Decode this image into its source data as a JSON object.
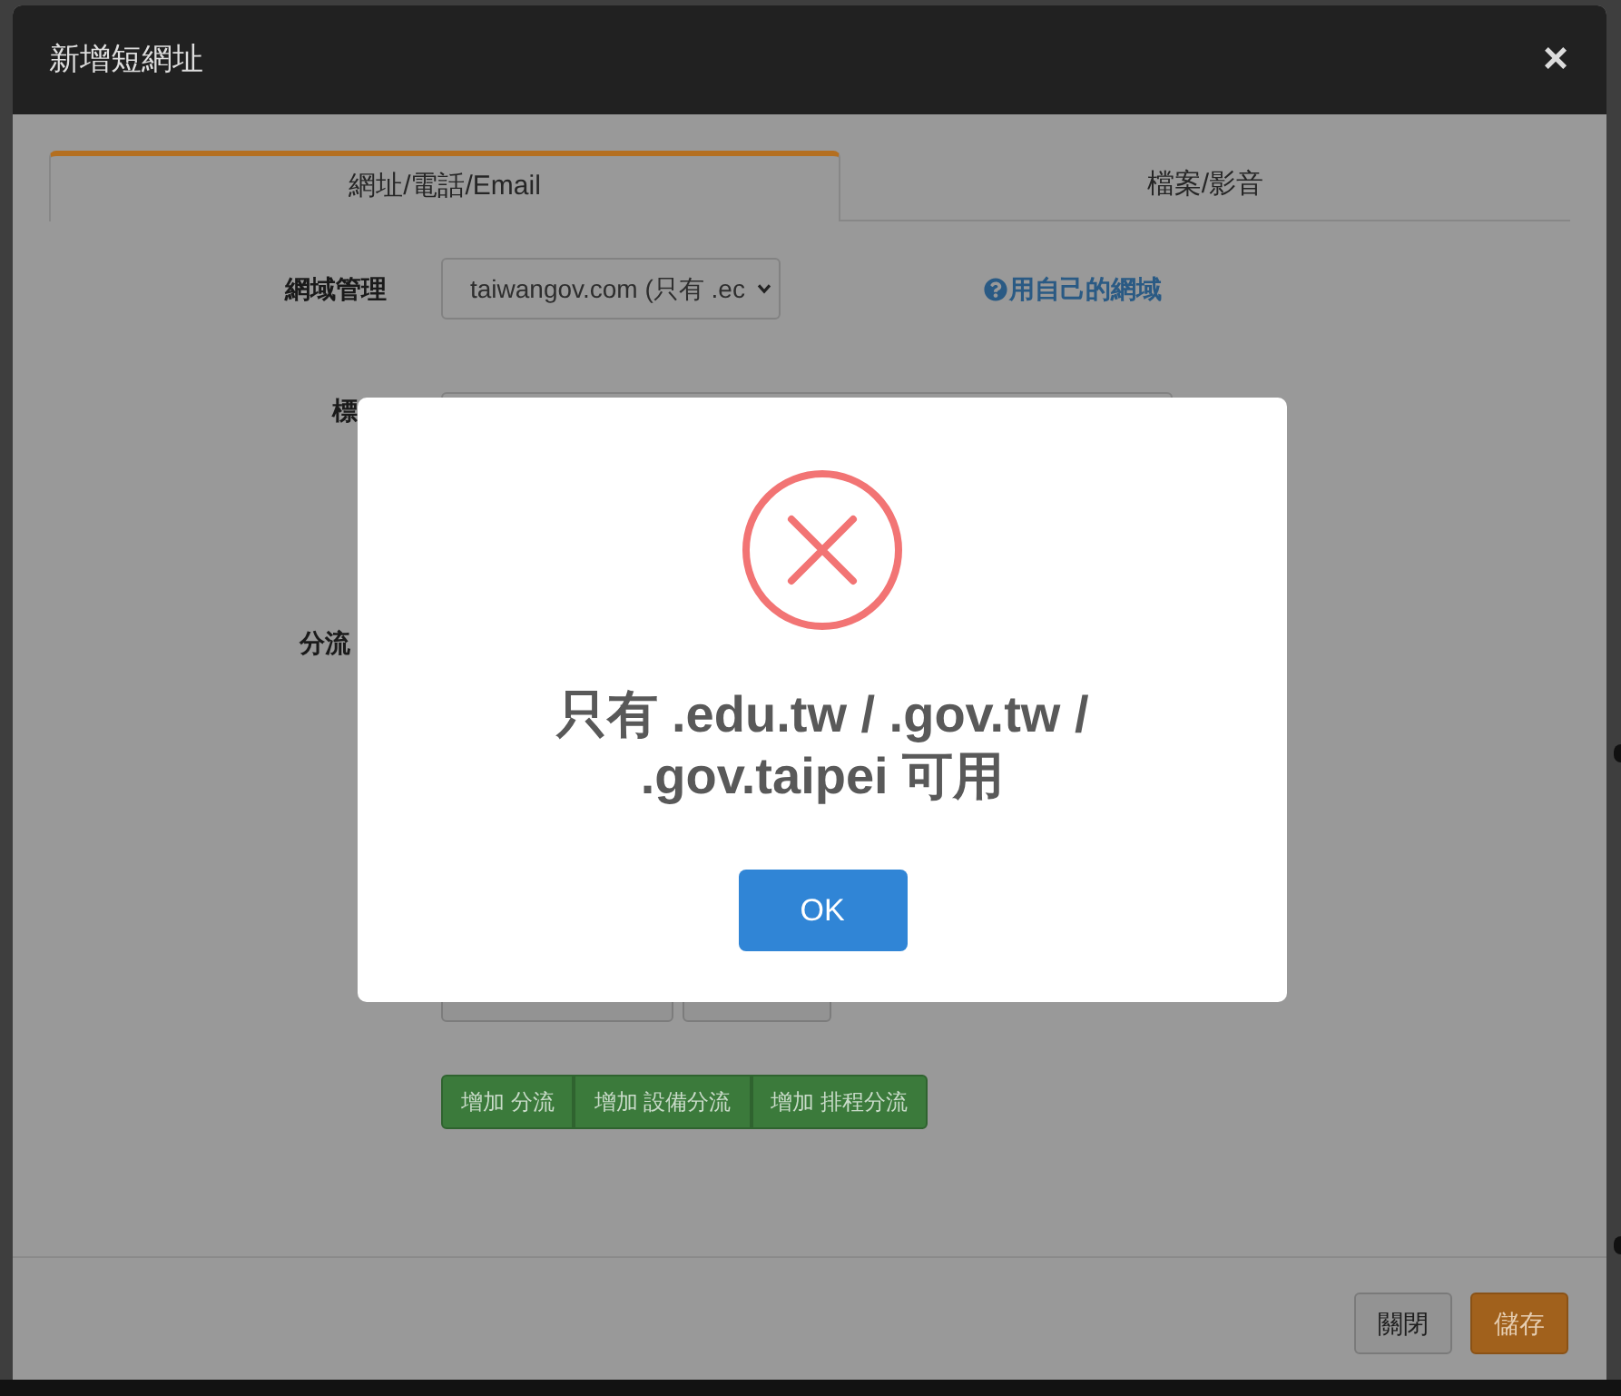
{
  "window": {
    "title": "新增短網址",
    "close": "×"
  },
  "tabs": [
    {
      "label": "網址/電話/Email",
      "selected": true
    },
    {
      "label": "檔案/影音",
      "selected": false
    }
  ],
  "form": {
    "domain": {
      "label": "網域管理",
      "value": "taiwangov.com (只有 .ec",
      "help_link": "用自己的網域"
    },
    "tag": {
      "label": "標"
    },
    "split": {
      "label": "分流"
    },
    "add_buttons": [
      "增加 分流",
      "增加 設備分流",
      "增加 排程分流"
    ]
  },
  "footer": {
    "buttons": [
      {
        "label": "關閉",
        "kind": "default"
      },
      {
        "label": "儲存",
        "kind": "primary"
      }
    ]
  },
  "alert": {
    "kind": "error",
    "message": "只有 .edu.tw / .gov.tw / .gov.taipei 可用",
    "button": "OK"
  }
}
